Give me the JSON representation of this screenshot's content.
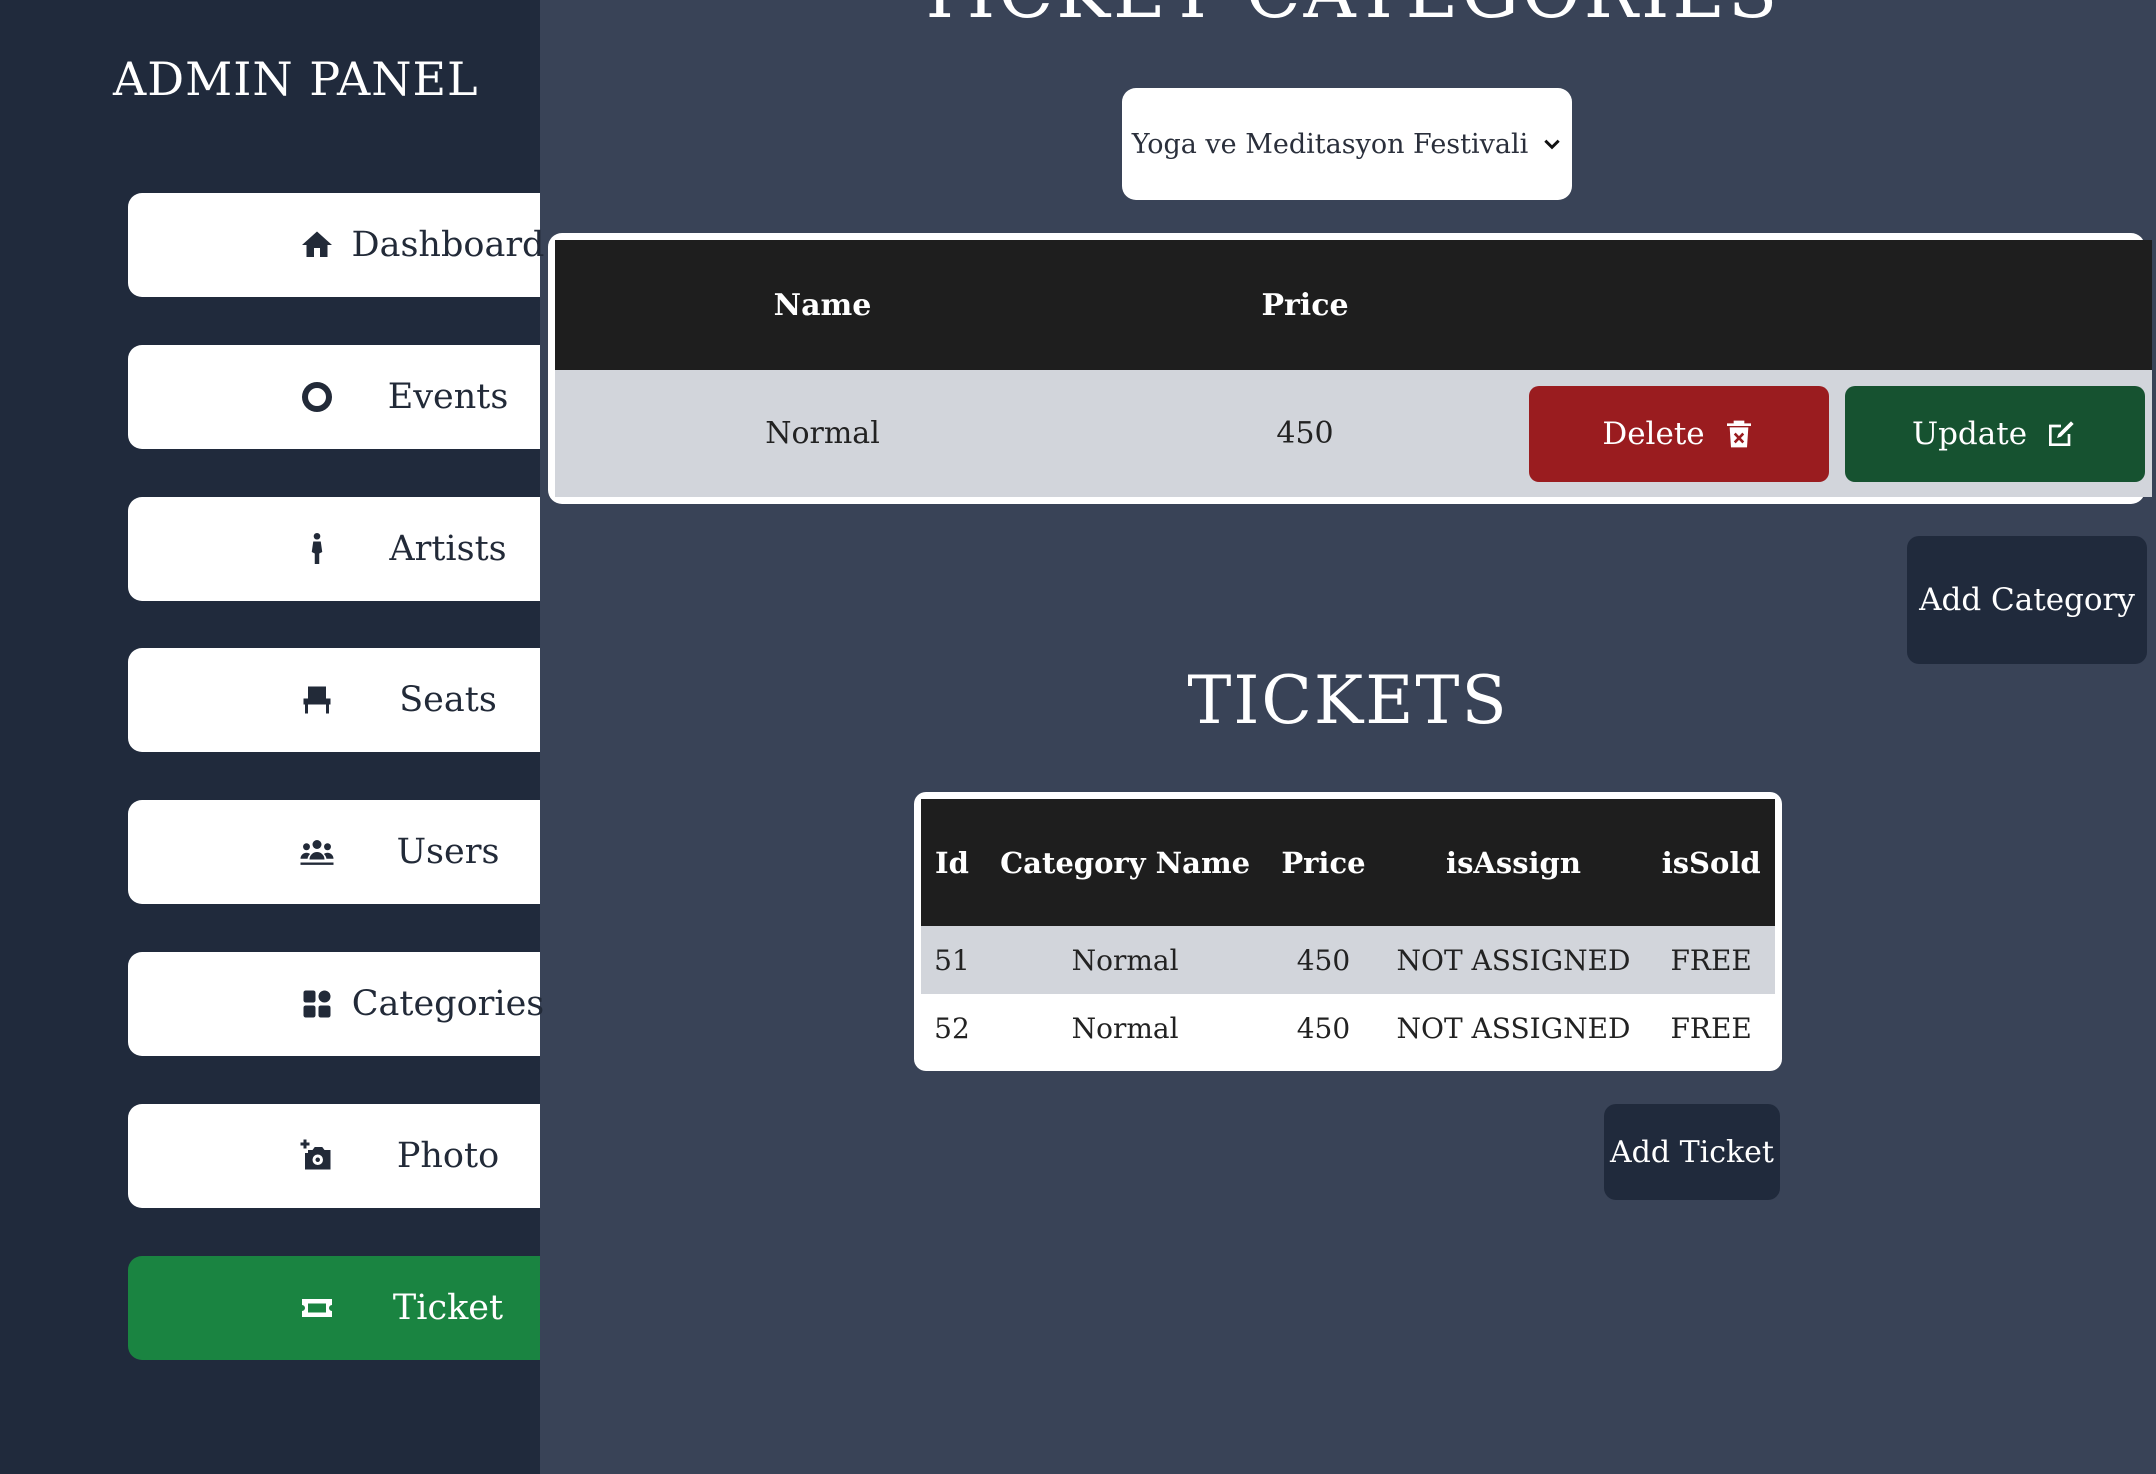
{
  "sidebar": {
    "brand": "ADMIN PANEL",
    "items": [
      {
        "label": "Dashboard",
        "icon": "home-icon"
      },
      {
        "label": "Events",
        "icon": "events-icon"
      },
      {
        "label": "Artists",
        "icon": "artist-icon"
      },
      {
        "label": "Seats",
        "icon": "seat-icon"
      },
      {
        "label": "Users",
        "icon": "users-icon"
      },
      {
        "label": "Categories",
        "icon": "categories-icon"
      },
      {
        "label": "Photo",
        "icon": "add-photo-icon"
      },
      {
        "label": "Ticket",
        "icon": "ticket-icon"
      }
    ],
    "active_index": 7
  },
  "main": {
    "page_title": "TICKET CATEGORIES",
    "event_select": {
      "value": "Yoga ve Meditasyon Festivali",
      "icon": "chevron-down-icon"
    },
    "categories_table": {
      "headers": [
        "Name",
        "Price"
      ],
      "rows": [
        {
          "name": "Normal",
          "price": "450"
        }
      ],
      "delete_label": "Delete",
      "update_label": "Update"
    },
    "add_category_label": "Add Category",
    "tickets_title": "TICKETS",
    "tickets_table": {
      "headers": [
        "Id",
        "Category Name",
        "Price",
        "isAssign",
        "isSold"
      ],
      "rows": [
        {
          "id": "51",
          "category": "Normal",
          "price": "450",
          "assign": "NOT ASSIGNED",
          "sold": "FREE"
        },
        {
          "id": "52",
          "category": "Normal",
          "price": "450",
          "assign": "NOT ASSIGNED",
          "sold": "FREE"
        }
      ]
    },
    "add_ticket_label": "Add Ticket"
  },
  "colors": {
    "sidebar_bg": "#202a3c",
    "main_bg": "#394357",
    "active_nav": "#1a8441",
    "delete": "#9a1c1f",
    "update": "#165230"
  }
}
